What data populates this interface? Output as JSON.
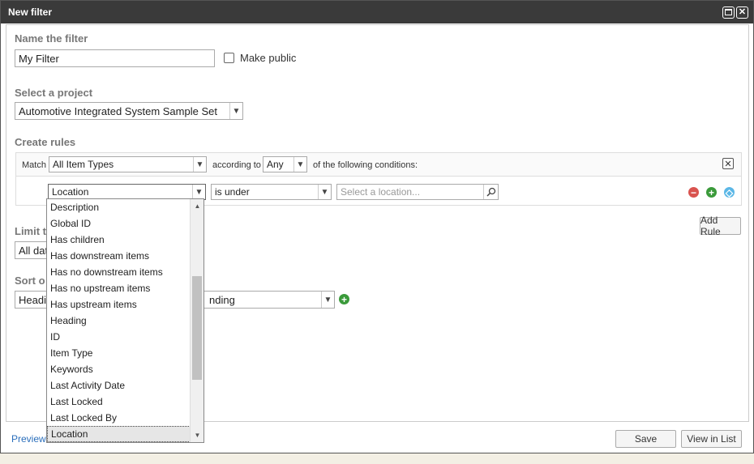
{
  "dialog": {
    "title": "New filter"
  },
  "name_section": {
    "label": "Name the filter",
    "value": "My Filter",
    "make_public_label": "Make public",
    "make_public_checked": false
  },
  "project_section": {
    "label": "Select a project",
    "selected": "Automotive Integrated System Sample Set"
  },
  "rules_section": {
    "label": "Create rules",
    "match_label": "Match",
    "item_types": "All Item Types",
    "according_to_label": "according to",
    "any_value": "Any",
    "conditions_label": "of the following conditions:",
    "rule": {
      "field": "Location",
      "operator": "is under",
      "value_placeholder": "Select a location..."
    },
    "add_rule_label": "Add Rule"
  },
  "limit_section": {
    "label": "Limit t",
    "value": "All dat"
  },
  "sort_section": {
    "label": "Sort o",
    "field": "Headin",
    "order": "nding"
  },
  "field_dropdown": {
    "items": [
      "Description",
      "Global ID",
      "Has children",
      "Has downstream items",
      "Has no downstream items",
      "Has no upstream items",
      "Has upstream items",
      "Heading",
      "ID",
      "Item Type",
      "Keywords",
      "Last Activity Date",
      "Last Locked",
      "Last Locked By",
      "Location"
    ],
    "selected": "Location"
  },
  "footer": {
    "preview_label": "Preview",
    "save_label": "Save",
    "view_in_list_label": "View in List"
  },
  "colors": {
    "titlebar": "#3a3a3a",
    "remove_icon": "#d9534f",
    "add_icon": "#3a9a3a",
    "info_icon": "#5bb7e6",
    "link": "#2a6ebb"
  }
}
